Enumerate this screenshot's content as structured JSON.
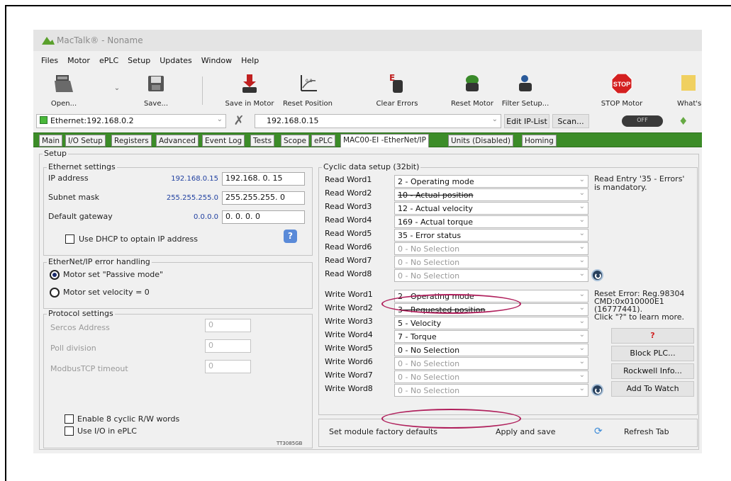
{
  "window_title": "MacTalk® - Noname",
  "menu": [
    "Files",
    "Motor",
    "ePLC",
    "Setup",
    "Updates",
    "Window",
    "Help"
  ],
  "toolbar": {
    "open": "Open...",
    "save": "Save...",
    "save_in_motor": "Save in Motor",
    "reset_position": "Reset Position",
    "clear_errors": "Clear Errors",
    "reset_motor": "Reset Motor",
    "filter_setup": "Filter Setup...",
    "stop_motor": "STOP Motor",
    "whats": "What's",
    "stop_text": "STOP"
  },
  "connection": {
    "interface": "Ethernet:192.168.0.2",
    "ip": "192.168.0.15",
    "edit_ip": "Edit IP-List",
    "scan": "Scan...",
    "toggle": "OFF"
  },
  "tabs": [
    "Main",
    "I/O Setup",
    "Registers",
    "Advanced",
    "Event Log",
    "Tests",
    "Scope",
    "ePLC",
    "MAC00-EI -EtherNet/IP",
    "Units (Disabled)",
    "Homing"
  ],
  "setup": {
    "title": "Setup",
    "ethernet": {
      "title": "Ethernet settings",
      "ip_label": "IP address",
      "ip_current": "192.168.0.15",
      "ip_value": "192.168.  0. 15",
      "subnet_label": "Subnet mask",
      "subnet_current": "255.255.255.0",
      "subnet_value": "255.255.255.  0",
      "gateway_label": "Default gateway",
      "gateway_current": "0.0.0.0",
      "gateway_value": "  0.  0.  0.  0",
      "dhcp_label": "Use DHCP to optain IP address",
      "help": "?"
    },
    "error_handling": {
      "title": "EtherNet/IP error handling",
      "opt1": "Motor set \"Passive mode\"",
      "opt2": "Motor set velocity = 0"
    },
    "protocol": {
      "title": "Protocol settings",
      "sercos_label": "Sercos Address",
      "sercos_value": "0",
      "poll_label": "Poll division",
      "poll_value": "0",
      "modbus_label": "ModbusTCP timeout",
      "modbus_value": "0"
    },
    "enable8": "Enable 8 cyclic R/W words",
    "use_io": "Use I/O in ePLC",
    "doc_code": "TT3085GB"
  },
  "cyclic": {
    "title": "Cyclic data setup (32bit)",
    "read": [
      {
        "label": "Read Word1",
        "value": "2 - Operating mode"
      },
      {
        "label": "Read Word2",
        "value": "10 - Actual position"
      },
      {
        "label": "Read Word3",
        "value": "12 - Actual velocity"
      },
      {
        "label": "Read Word4",
        "value": "169 - Actual torque"
      },
      {
        "label": "Read Word5",
        "value": "35 - Error status"
      },
      {
        "label": "Read Word6",
        "value": "0 - No Selection"
      },
      {
        "label": "Read Word7",
        "value": "0 - No Selection"
      },
      {
        "label": "Read Word8",
        "value": "0 - No Selection"
      }
    ],
    "write": [
      {
        "label": "Write Word1",
        "value": "2 - Operating mode"
      },
      {
        "label": "Write Word2",
        "value": "3 - Requested position"
      },
      {
        "label": "Write Word3",
        "value": "5 - Velocity"
      },
      {
        "label": "Write Word4",
        "value": "7 - Torque"
      },
      {
        "label": "Write Word5",
        "value": "0 - No Selection"
      },
      {
        "label": "Write Word6",
        "value": "0 - No Selection"
      },
      {
        "label": "Write Word7",
        "value": "0 - No Selection"
      },
      {
        "label": "Write Word8",
        "value": "0 - No Selection"
      }
    ],
    "read_note": [
      "Read Entry '35 - Errors'",
      "is mandatory."
    ],
    "write_note": [
      "Reset Error: Reg.98304",
      "CMD:0x010000E1",
      "(16777441).",
      "Click \"?\" to learn more."
    ],
    "buttons": {
      "help": "?",
      "block_plc": "Block PLC...",
      "rockwell": "Rockwell Info...",
      "add_watch": "Add To Watch"
    }
  },
  "bottom": {
    "factory": "Set module factory defaults",
    "apply": "Apply and save",
    "refresh": "Refresh Tab"
  }
}
